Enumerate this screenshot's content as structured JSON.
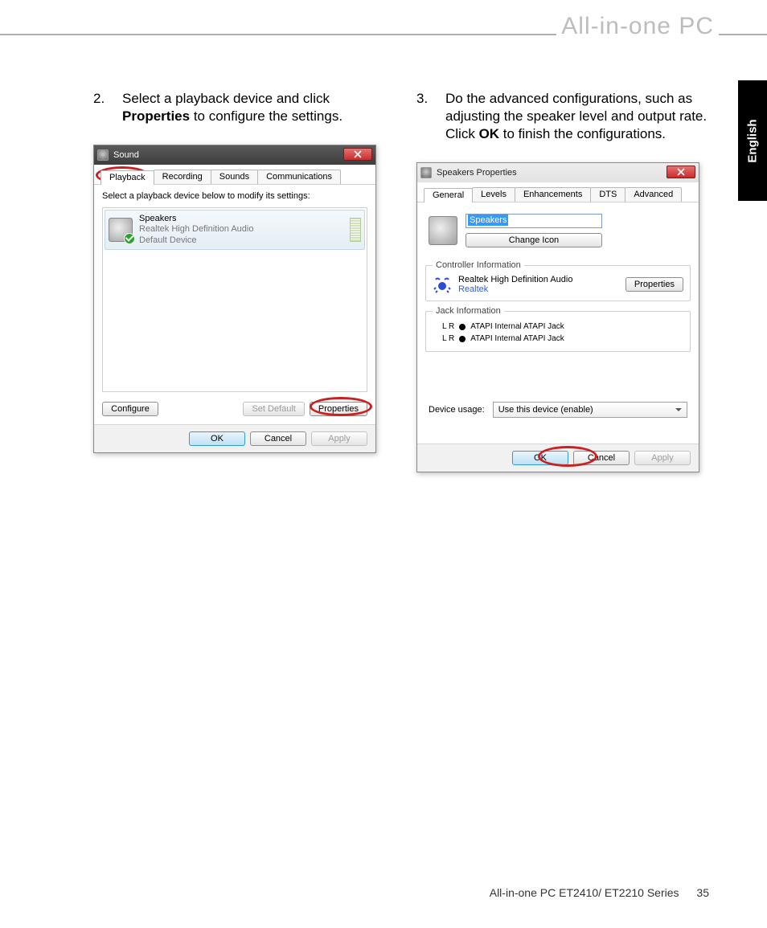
{
  "page": {
    "header_title": "All-in-one PC",
    "language_tab": "English",
    "footer_model": "All-in-one PC ET2410/ ET2210 Series",
    "footer_page": "35"
  },
  "steps": {
    "s2": {
      "num": "2.",
      "pre": "Select a playback device and click ",
      "bold": "Properties",
      "post": " to configure the settings."
    },
    "s3": {
      "num": "3.",
      "pre": "Do the advanced configurations, such as adjusting the speaker level and output rate. Click ",
      "bold": "OK",
      "post": " to finish the configurations."
    }
  },
  "sound_dialog": {
    "title": "Sound",
    "tabs": [
      "Playback",
      "Recording",
      "Sounds",
      "Communications"
    ],
    "instruction": "Select a playback device below to modify its settings:",
    "device": {
      "name": "Speakers",
      "driver": "Realtek High Definition Audio",
      "status": "Default Device"
    },
    "buttons": {
      "configure": "Configure",
      "set_default": "Set Default",
      "properties": "Properties",
      "ok": "OK",
      "cancel": "Cancel",
      "apply": "Apply"
    }
  },
  "props_dialog": {
    "title": "Speakers Properties",
    "tabs": [
      "General",
      "Levels",
      "Enhancements",
      "DTS",
      "Advanced"
    ],
    "device_name": "Speakers",
    "change_icon": "Change Icon",
    "controller_group": "Controller Information",
    "controller_name": "Realtek High Definition Audio",
    "controller_vendor": "Realtek",
    "properties_btn": "Properties",
    "jack_group": "Jack Information",
    "jack_lr": "L R",
    "jack_label": "ATAPI Internal ATAPI Jack",
    "usage_label": "Device usage:",
    "usage_value": "Use this device (enable)",
    "ok": "OK",
    "cancel": "Cancel",
    "apply": "Apply"
  }
}
